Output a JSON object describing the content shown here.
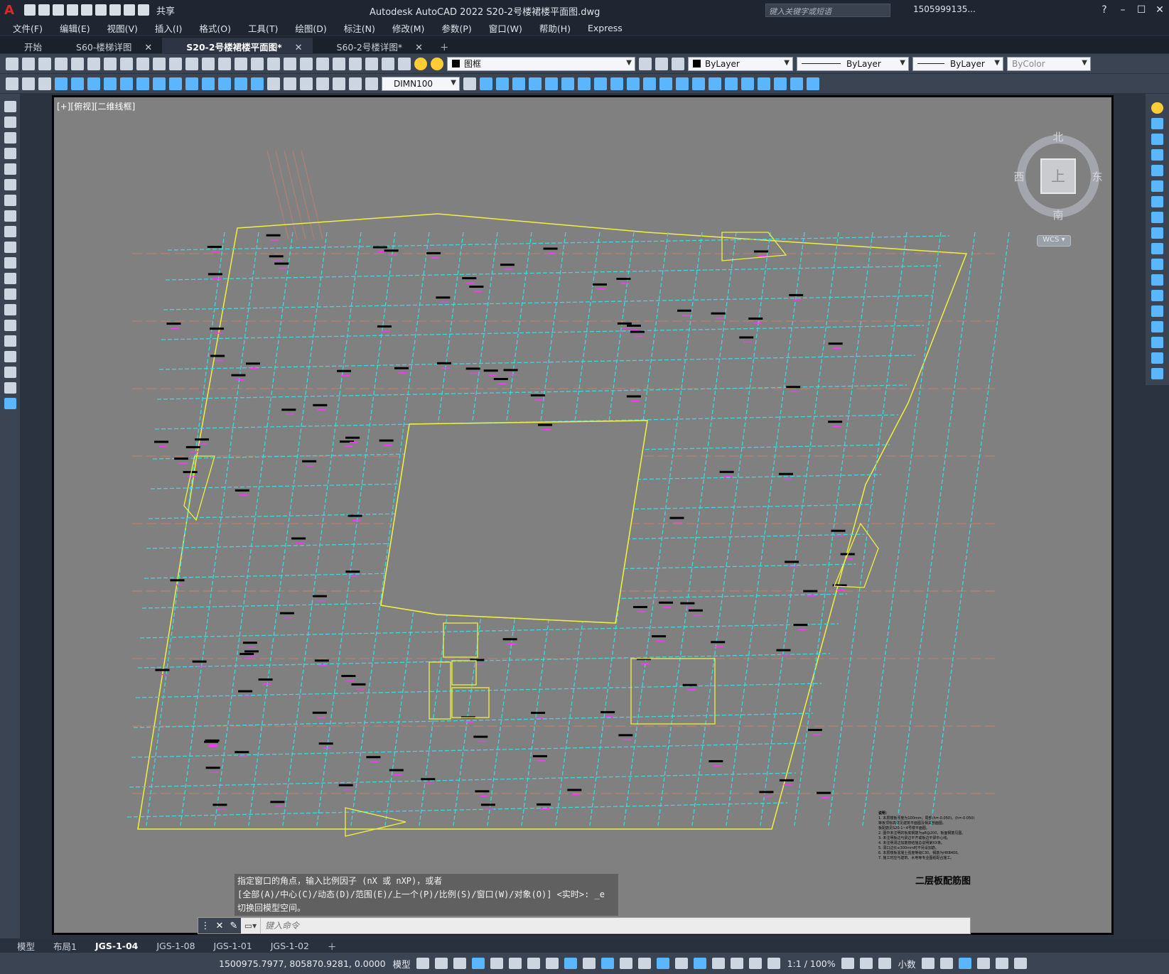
{
  "titlebar": {
    "app_logo": "A",
    "share_label": "共享",
    "title": "Autodesk AutoCAD 2022    S20-2号楼裙楼平面图.dwg",
    "search_placeholder": "键入关键字或短语",
    "user": "1505999135..."
  },
  "menubar": {
    "items": [
      "文件(F)",
      "编辑(E)",
      "视图(V)",
      "插入(I)",
      "格式(O)",
      "工具(T)",
      "绘图(D)",
      "标注(N)",
      "修改(M)",
      "参数(P)",
      "窗口(W)",
      "帮助(H)",
      "Express"
    ]
  },
  "doctabs": {
    "tabs": [
      {
        "label": "开始"
      },
      {
        "label": "S60-楼梯详图"
      },
      {
        "label": "S20-2号楼裙楼平面图*"
      },
      {
        "label": "S60-2号楼详图*"
      }
    ]
  },
  "properties": {
    "layer": "图框",
    "color": "ByLayer",
    "linetype": "ByLayer",
    "lineweight": "ByLayer",
    "plotstyle": "ByColor",
    "dimstyle": "DIMN100"
  },
  "canvas": {
    "viewport_label": "[+][俯视][二维线框]",
    "viewcube": {
      "north": "北",
      "south": "南",
      "east": "东",
      "west": "西",
      "face": "上"
    },
    "wcs": "WCS",
    "drawing_title": "二层板配筋图",
    "notes_heading": "说明：",
    "notes_lines": [
      "1. 本层楼板厚度为100mm；局部(h=-0.050)、(h=-0.050)",
      "   等板顶标高详见建筑平面图及相关剖面图。",
      "   板配筋见S20-1~4号楼平面图。",
      "2. 图中未注明的板底钢筋为φ8@200，板面钢筋见图。",
      "3. 未注明板边与梁边平齐或板边平梁中心线。",
      "4. 未注明洞边加筋按结施总说明第XX条。",
      "5. 洞口边长≤300mm时不另设加筋。",
      "6. 本层楼板混凝土强度等级C30，钢筋为HRB400。",
      "7. 施工时应与建筑、水电等专业图纸配合施工。"
    ],
    "colors": {
      "slab_outline": "#f0f040",
      "grid": "#3fd6e0",
      "rebar": "#ff33ff",
      "axis": "#e08060",
      "background": "#808080"
    }
  },
  "command": {
    "history": [
      "指定窗口的角点，输入比例因子 (nX 或 nXP)，或者",
      "[全部(A)/中心(C)/动态(D)/范围(E)/上一个(P)/比例(S)/窗口(W)/对象(O)] <实时>: _e",
      "切换回模型空间。"
    ],
    "placeholder": "键入命令"
  },
  "layouttabs": {
    "tabs": [
      "模型",
      "布局1",
      "JGS-1-04",
      "JGS-1-08",
      "JGS-1-01",
      "JGS-1-02"
    ],
    "active": "JGS-1-04"
  },
  "statusbar": {
    "coords": "1500975.7977, 805870.9281, 0.0000",
    "space": "模型",
    "scale": "1:1 / 100%",
    "units": "小数"
  }
}
